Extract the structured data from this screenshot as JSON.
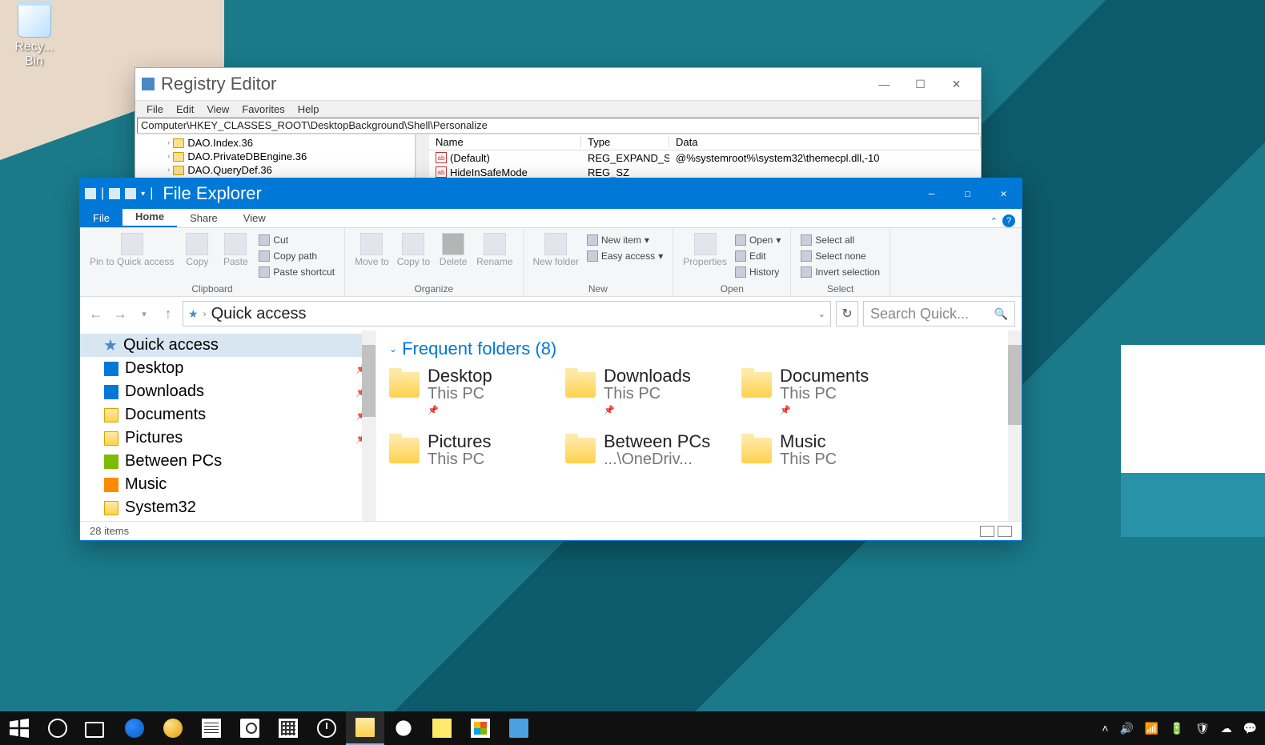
{
  "desktop": {
    "recycle_bin": "Recy...\nBin"
  },
  "regedit": {
    "title": "Registry Editor",
    "menu": [
      "File",
      "Edit",
      "View",
      "Favorites",
      "Help"
    ],
    "address": "Computer\\HKEY_CLASSES_ROOT\\DesktopBackground\\Shell\\Personalize",
    "tree": [
      "DAO.Index.36",
      "DAO.PrivateDBEngine.36",
      "DAO.QueryDef.36"
    ],
    "cols": {
      "name": "Name",
      "type": "Type",
      "data": "Data"
    },
    "rows": [
      {
        "name": "(Default)",
        "type": "REG_EXPAND_SZ",
        "data": "@%systemroot%\\system32\\themecpl.dll,-10"
      },
      {
        "name": "HideInSafeMode",
        "type": "REG_SZ",
        "data": ""
      }
    ]
  },
  "explorer": {
    "title": "File Explorer",
    "tabs": {
      "file": "File",
      "home": "Home",
      "share": "Share",
      "view": "View"
    },
    "ribbon": {
      "clipboard": {
        "label": "Clipboard",
        "pin": "Pin to Quick access",
        "copy": "Copy",
        "paste": "Paste",
        "cut": "Cut",
        "copypath": "Copy path",
        "pasteshort": "Paste shortcut"
      },
      "organize": {
        "label": "Organize",
        "move": "Move to",
        "copyto": "Copy to",
        "delete": "Delete",
        "rename": "Rename"
      },
      "new": {
        "label": "New",
        "newfolder": "New folder",
        "newitem": "New item",
        "easy": "Easy access"
      },
      "open": {
        "label": "Open",
        "properties": "Properties",
        "open": "Open",
        "edit": "Edit",
        "history": "History"
      },
      "select": {
        "label": "Select",
        "all": "Select all",
        "none": "Select none",
        "invert": "Invert selection"
      }
    },
    "breadcrumb": "Quick access",
    "search_placeholder": "Search Quick...",
    "nav": [
      {
        "label": "Quick access",
        "icon": "star",
        "selected": true,
        "pin": false
      },
      {
        "label": "Desktop",
        "icon": "blue",
        "pin": true
      },
      {
        "label": "Downloads",
        "icon": "blue",
        "pin": true
      },
      {
        "label": "Documents",
        "icon": "folder",
        "pin": true
      },
      {
        "label": "Pictures",
        "icon": "folder",
        "pin": true
      },
      {
        "label": "Between PCs",
        "icon": "green",
        "pin": false
      },
      {
        "label": "Music",
        "icon": "orange",
        "pin": false
      },
      {
        "label": "System32",
        "icon": "folder",
        "pin": false
      }
    ],
    "section_title": "Frequent folders (8)",
    "folders": [
      {
        "name": "Desktop",
        "location": "This PC",
        "pin": true
      },
      {
        "name": "Downloads",
        "location": "This PC",
        "pin": true
      },
      {
        "name": "Documents",
        "location": "This PC",
        "pin": true
      },
      {
        "name": "Pictures",
        "location": "This PC",
        "pin": false
      },
      {
        "name": "Between PCs",
        "location": "...\\OneDriv...",
        "pin": false
      },
      {
        "name": "Music",
        "location": "This PC",
        "pin": false
      }
    ],
    "status": "28 items"
  },
  "taskbar": {
    "time": "",
    "tray_icons": [
      "chevron-up",
      "volume",
      "network",
      "battery",
      "defender",
      "onedrive",
      "action-center"
    ]
  }
}
